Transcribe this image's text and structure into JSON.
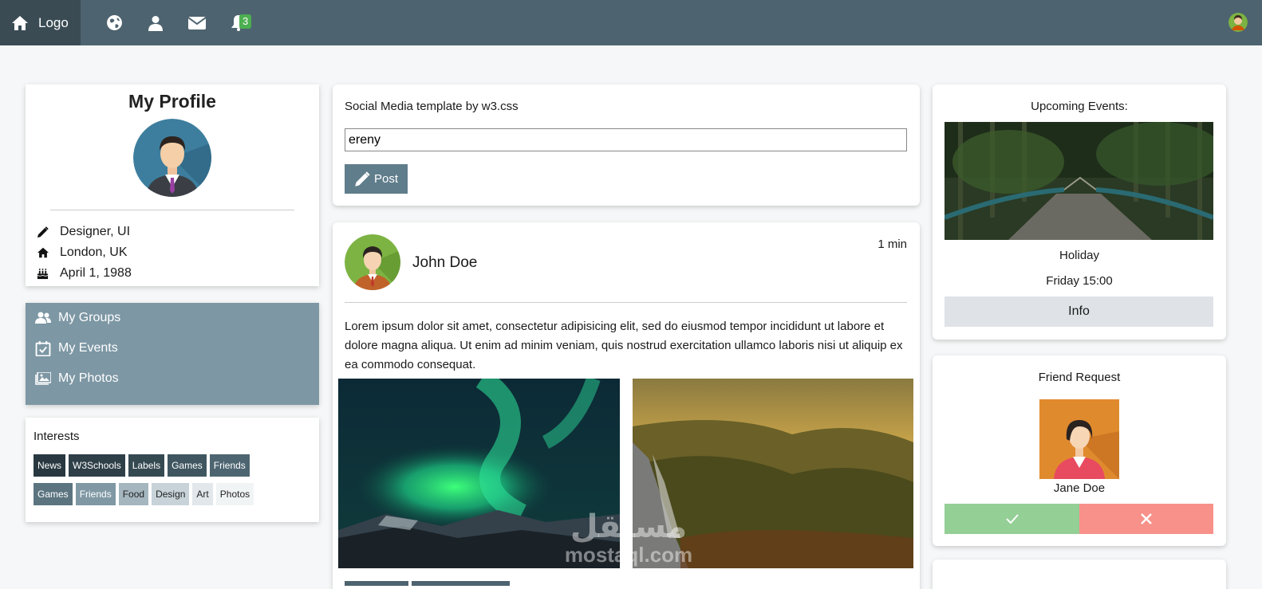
{
  "nav": {
    "logo": "Logo",
    "badge": "3",
    "icons": [
      "home-icon",
      "globe-icon",
      "user-icon",
      "envelope-icon",
      "bell-icon"
    ]
  },
  "profile": {
    "title": "My Profile",
    "job": "Designer, UI",
    "location": "London, UK",
    "birthday": "April 1, 1988"
  },
  "menu": {
    "items": [
      {
        "label": "My Groups",
        "icon": "users-icon"
      },
      {
        "label": "My Events",
        "icon": "calendar-check-icon"
      },
      {
        "label": "My Photos",
        "icon": "photos-icon"
      }
    ]
  },
  "interests": {
    "title": "Interests",
    "row1": [
      "News",
      "W3Schools",
      "Labels",
      "Games",
      "Friends"
    ],
    "row2": [
      "Games",
      "Friends",
      "Food",
      "Design",
      "Art",
      "Photos"
    ]
  },
  "composer": {
    "title": "Social Media template by w3.css",
    "input_value": "ereny",
    "post_label": "Post"
  },
  "post": {
    "author": "John Doe",
    "time": "1 min",
    "body": "Lorem ipsum dolor sit amet, consectetur adipisicing elit, sed do eiusmod tempor incididunt ut labore et dolore magna aliqua. Ut enim ad minim veniam, quis nostrud exercitation ullamco laboris nisi ut aliquip ex ea commodo consequat."
  },
  "events": {
    "title": "Upcoming Events:",
    "name": "Holiday",
    "date": "Friday 15:00",
    "info_label": "Info"
  },
  "friend": {
    "title": "Friend Request",
    "name": "Jane Doe"
  },
  "watermark": {
    "arabic": "مستقل",
    "latin": "mostaql.com"
  },
  "colors": {
    "nav": "#4d636f",
    "nav_dark": "#3a4b54",
    "menu": "#7d97a4",
    "accept": "#94cf95",
    "decline": "#f7918a",
    "badge": "#4caf50"
  }
}
